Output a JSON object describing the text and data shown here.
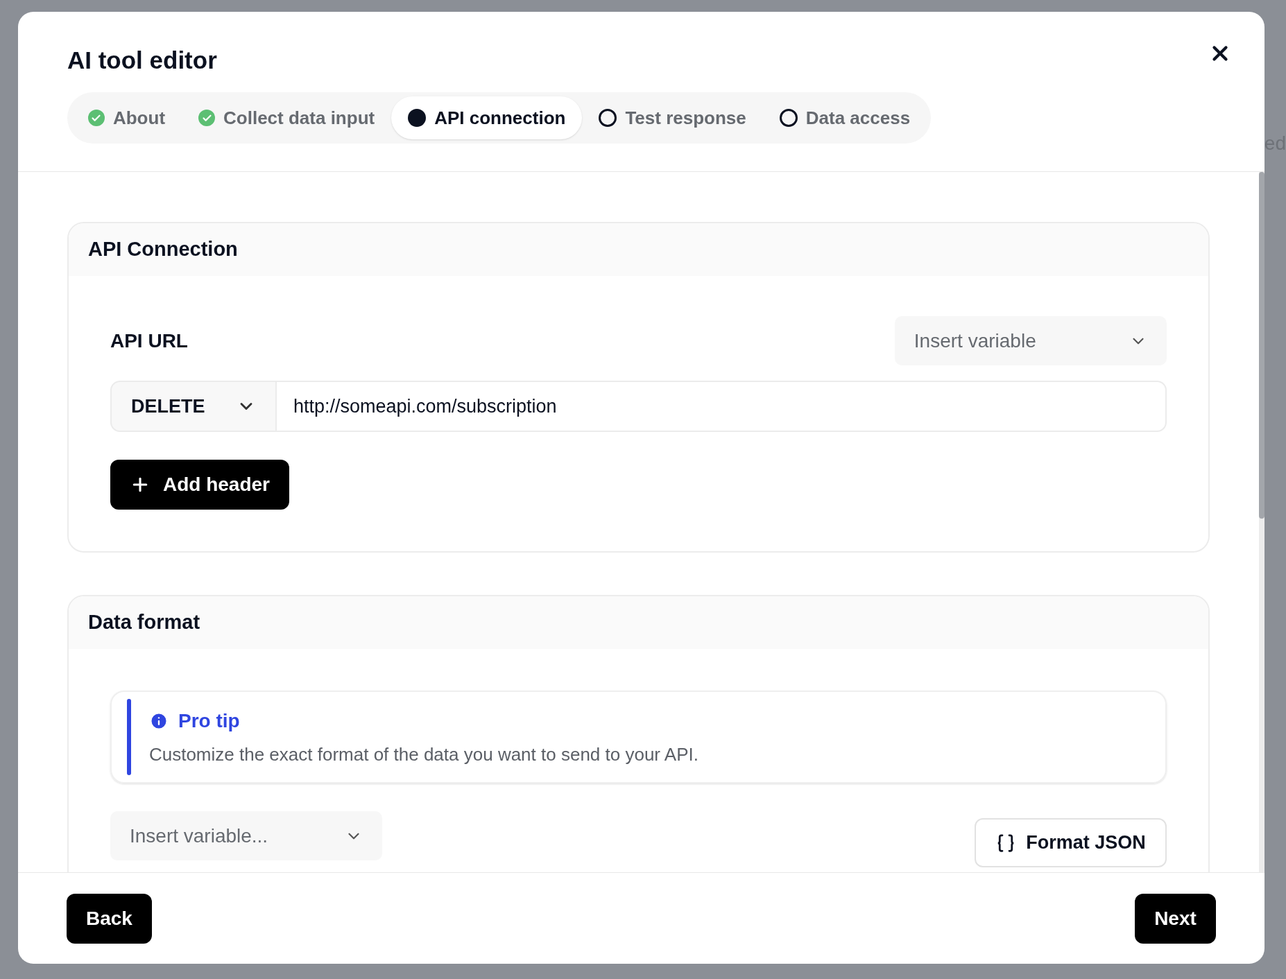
{
  "backdrop": {
    "text": "ed"
  },
  "dialog": {
    "title": "AI tool editor"
  },
  "steps": [
    {
      "label": "About",
      "kind": "done",
      "selected": false
    },
    {
      "label": "Collect data input",
      "kind": "done",
      "selected": false
    },
    {
      "label": "API connection",
      "kind": "current",
      "selected": true
    },
    {
      "label": "Test response",
      "kind": "todo",
      "selected": false
    },
    {
      "label": "Data access",
      "kind": "todo",
      "selected": false
    }
  ],
  "api_connection": {
    "title": "API Connection",
    "url_label": "API URL",
    "insert_variable": {
      "placeholder": "Insert variable"
    },
    "method": "DELETE",
    "url": "http://someapi.com/subscription",
    "add_header": "Add header"
  },
  "data_format": {
    "title": "Data format",
    "tip": {
      "title": "Pro tip",
      "text": "Customize the exact format of the data you want to send to your API."
    },
    "insert_variable": {
      "placeholder": "Insert variable..."
    },
    "format_button": "Format JSON"
  },
  "footer": {
    "back": "Back",
    "next": "Next"
  }
}
